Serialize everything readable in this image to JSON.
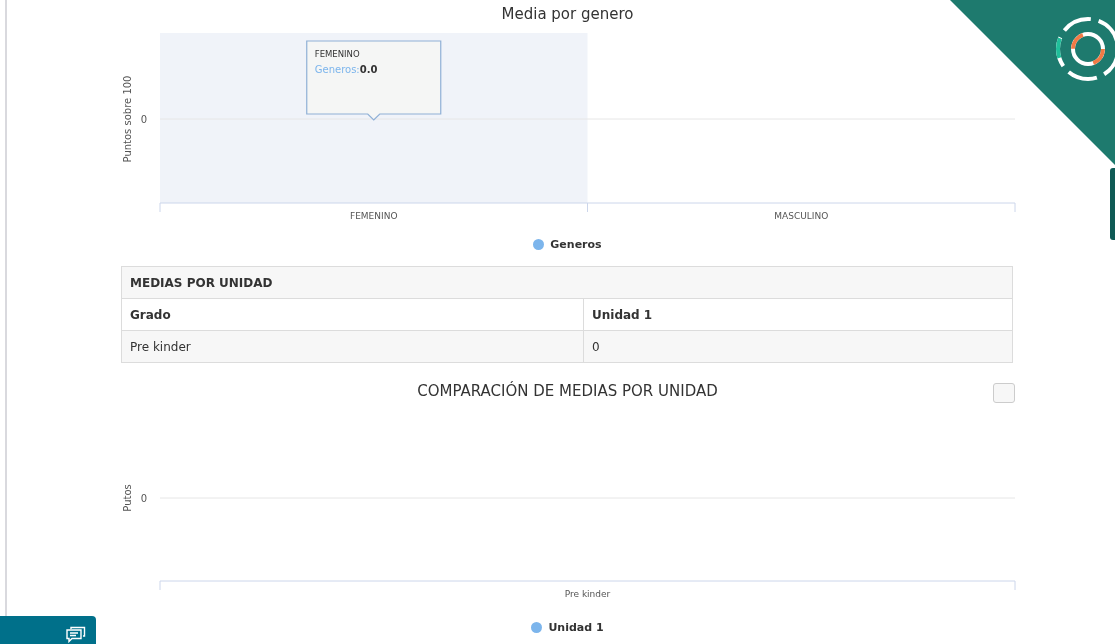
{
  "gender_chart": {
    "title": "Media por genero",
    "y_axis_title": "Puntos sobre 100",
    "y_tick": "0",
    "categories": [
      {
        "label": "FEMENINO",
        "selected": true
      },
      {
        "label": "MASCULINO",
        "selected": false
      }
    ],
    "tooltip": {
      "category": "FEMENINO",
      "series": "Generos:",
      "value": "0.0"
    },
    "legend": [
      {
        "label": "Generos",
        "color": "#7cb5ec"
      }
    ]
  },
  "units_table": {
    "title": "MEDIAS POR UNIDAD",
    "columns": [
      "Grado",
      "Unidad 1"
    ],
    "rows": [
      [
        "Pre kinder",
        "0"
      ]
    ]
  },
  "unit_chart": {
    "title": "COMPARACIÓN DE MEDIAS POR UNIDAD",
    "y_axis_title": "Putos",
    "y_tick": "0",
    "categories": [
      {
        "label": "Pre kinder",
        "selected": false
      }
    ],
    "legend": [
      {
        "label": "Unidad 1",
        "color": "#7cb5ec"
      }
    ]
  }
}
